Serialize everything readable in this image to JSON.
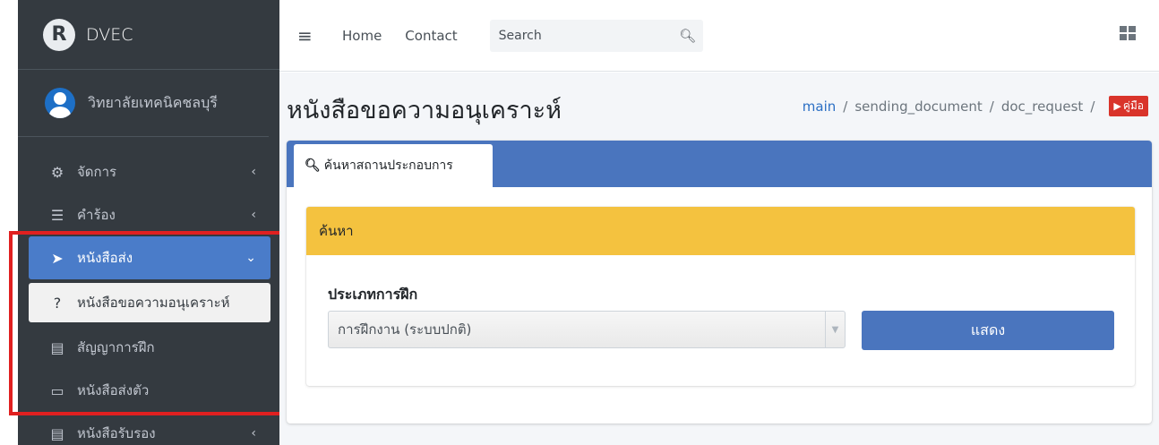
{
  "brand": {
    "logo": "R",
    "name": "DVEC"
  },
  "user": {
    "name": "วิทยาลัยเทคนิคชลบุรี"
  },
  "sidebar": {
    "items": [
      {
        "label": "จัดการ",
        "icon": "cogs-icon"
      },
      {
        "label": "คำร้อง",
        "icon": "list-icon"
      },
      {
        "label": "หนังสือส่ง",
        "icon": "paper-plane-icon"
      },
      {
        "label": "หนังสือขอความอนุเคราะห์",
        "icon": "question-circle-icon"
      },
      {
        "label": "สัญญาการฝึก",
        "icon": "file-icon"
      },
      {
        "label": "หนังสือส่งตัว",
        "icon": "bus-icon"
      },
      {
        "label": "หนังสือรับรอง",
        "icon": "file-icon"
      }
    ]
  },
  "topbar": {
    "home": "Home",
    "contact": "Contact",
    "search_placeholder": "Search"
  },
  "page": {
    "title": "หนังสือขอความอนุเคราะห์",
    "breadcrumb": [
      "main",
      "sending_document",
      "doc_request"
    ],
    "manual_label": "คู่มือ"
  },
  "tab": {
    "label": "ค้นหาสถานประกอบการ"
  },
  "search_panel": {
    "header": "ค้นหา",
    "field_label": "ประเภทการฝึก",
    "selected_value": "การฝึกงาน (ระบบปกติ)",
    "button_label": "แสดง"
  },
  "colors": {
    "sidebar_bg": "#343a40",
    "accent_blue": "#4a75be",
    "warning_yellow": "#f4c23f",
    "manual_red": "#d9342b",
    "highlight_red": "#e02020"
  }
}
